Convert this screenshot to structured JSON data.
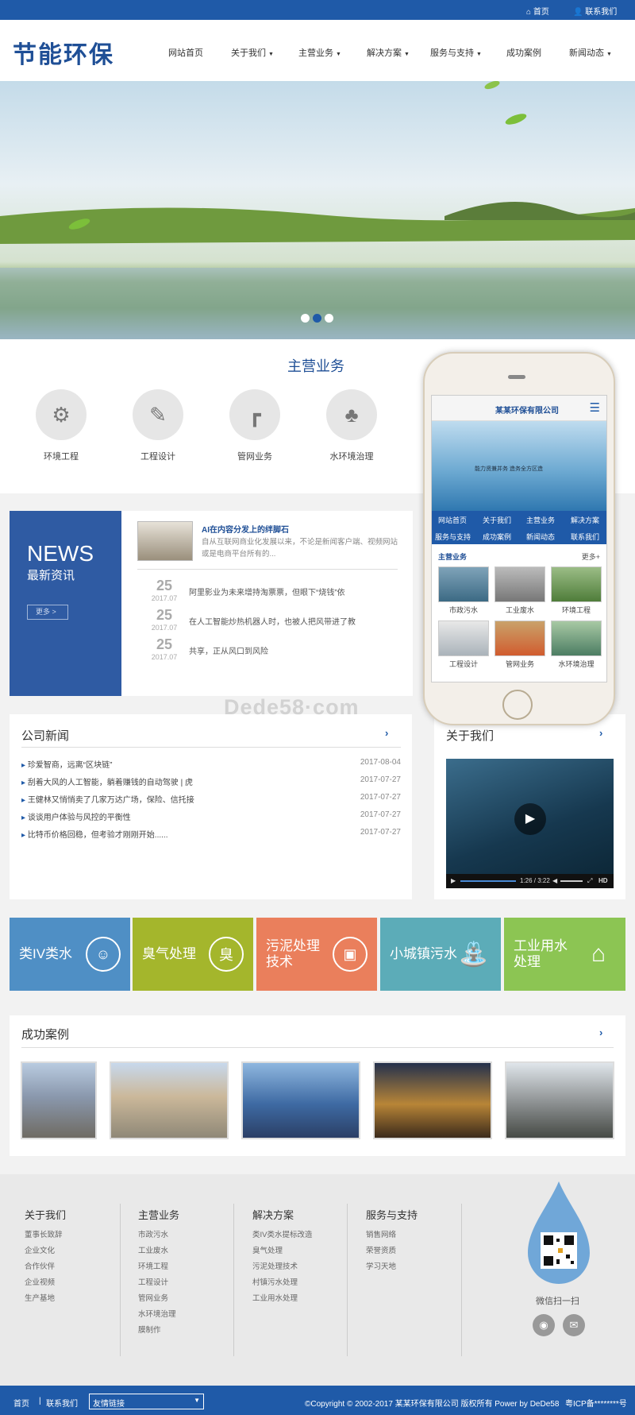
{
  "topbar": {
    "home": "首页",
    "contact": "联系我们"
  },
  "logo": "节能环保",
  "nav": {
    "items": [
      {
        "label": "网站首页",
        "caret": false
      },
      {
        "label": "关于我们",
        "caret": true
      },
      {
        "label": "主营业务",
        "caret": true
      },
      {
        "label": "解决方案",
        "caret": true
      },
      {
        "label": "服务与支持",
        "caret": true
      },
      {
        "label": "成功案例",
        "caret": false
      },
      {
        "label": "新闻动态",
        "caret": true
      }
    ]
  },
  "banner": {
    "dots": 3,
    "active_dot": 2
  },
  "services": {
    "title": "主营业务",
    "items": [
      {
        "label": "环境工程",
        "icon": "gear-icon"
      },
      {
        "label": "工程设计",
        "icon": "design-icon"
      },
      {
        "label": "管网业务",
        "icon": "pipe-icon"
      },
      {
        "label": "水环境治理",
        "icon": "tree-icon"
      }
    ]
  },
  "news": {
    "title_en": "NEWS",
    "title_cn": "最新资讯",
    "more": "更多 >",
    "featured": {
      "title": "AI在内容分发上的绊脚石",
      "summary": "自从互联网商业化发展以来，不论是新闻客户端、视频网站或是电商平台所有的..."
    },
    "list": [
      {
        "day": "25",
        "month": "2017.07",
        "text": "阿里影业为未来增持淘票票，但眼下“烧钱”依"
      },
      {
        "day": "25",
        "month": "2017.07",
        "text": "在人工智能炒热机器人时，也被人把风带进了教"
      },
      {
        "day": "25",
        "month": "2017.07",
        "text": "共享，正从风口到风险"
      }
    ]
  },
  "company_news": {
    "title": "公司新闻",
    "more": "›",
    "items": [
      {
        "text": "珍爱智商，远离“区块链”",
        "date": "2017-08-04"
      },
      {
        "text": "刮着大风的人工智能，躺着赚钱的自动驾驶 | 虎",
        "date": "2017-07-27"
      },
      {
        "text": "王健林又悄悄卖了几家万达广场，保险、信托接",
        "date": "2017-07-27"
      },
      {
        "text": "谈谈用户体验与风控的平衡性",
        "date": "2017-07-27"
      },
      {
        "text": "比特币价格回稳，但考验才刚刚开始......",
        "date": "2017-07-27"
      }
    ]
  },
  "about": {
    "title": "关于我们",
    "more": "›",
    "video_time": "1:26",
    "video_total": "3:22",
    "hd": "HD"
  },
  "watermark": "Dede58·com",
  "tiles": [
    {
      "label": "类IV类水",
      "color": "#4f8fc5",
      "icon": "drop-face-icon"
    },
    {
      "label": "臭气处理",
      "color": "#a4b62c",
      "icon": "map-pin-icon"
    },
    {
      "label": "污泥处理技术",
      "color": "#ea7f5c",
      "icon": "sludge-icon"
    },
    {
      "label": "小城镇污水",
      "color": "#5cacb8",
      "icon": "faucet-icon"
    },
    {
      "label": "工业用水处理",
      "color": "#8cc553",
      "icon": "house-water-icon"
    }
  ],
  "cases": {
    "title": "成功案例",
    "more": "›",
    "count": 5
  },
  "phone": {
    "title": "某某环保有限公司",
    "banner_text": "能力贤兼并务  造务全方区造",
    "nav": [
      "网站首页",
      "关于我们",
      "主营业务",
      "解决方案",
      "服务与支持",
      "成功案例",
      "新闻动态",
      "联系我们"
    ],
    "section": "主营业务",
    "more": "更多+",
    "items": [
      "市政污水",
      "工业废水",
      "环境工程",
      "工程设计",
      "管网业务",
      "水环境治理"
    ]
  },
  "footer": {
    "columns": [
      {
        "title": "关于我们",
        "links": [
          "董事长致辞",
          "企业文化",
          "合作伙伴",
          "企业视频",
          "生产基地"
        ]
      },
      {
        "title": "主营业务",
        "links": [
          "市政污水",
          "工业废水",
          "环境工程",
          "工程设计",
          "管网业务",
          "水环境治理",
          "膜制作"
        ]
      },
      {
        "title": "解决方案",
        "links": [
          "类IV类水提标改造",
          "臭气处理",
          "污泥处理技术",
          "村镇污水处理",
          "工业用水处理"
        ]
      },
      {
        "title": "服务与支持",
        "links": [
          "销售网络",
          "荣誉资质",
          "学习天地"
        ]
      }
    ],
    "wechat": "微信扫一扫"
  },
  "bottom": {
    "contact": "联系我们",
    "links_label": "友情链接",
    "copyright": "©Copyright © 2002-2017 某某环保有限公司 版权所有 Power by DeDe58",
    "icp": "粤ICP备********号"
  },
  "colors": {
    "primary": "#1f5aa8",
    "news_box": "#2f5ba3",
    "title_blue": "#1f4f96"
  }
}
